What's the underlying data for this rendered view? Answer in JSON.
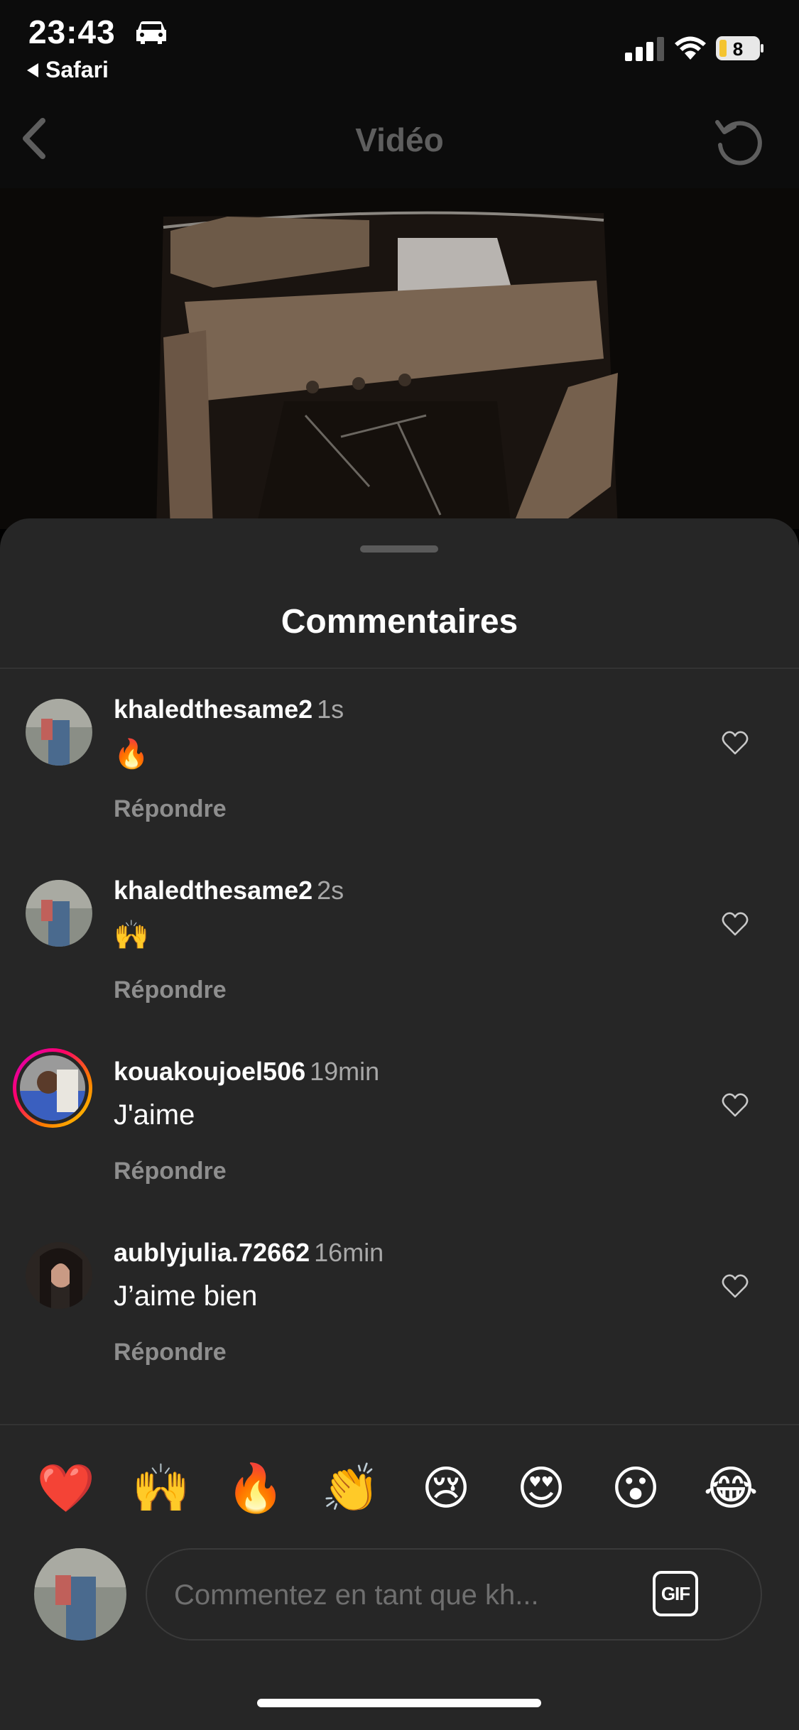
{
  "status_bar": {
    "time": "23:43",
    "back_app": "Safari",
    "battery": "8"
  },
  "nav": {
    "title": "Vidéo"
  },
  "sheet": {
    "title": "Commentaires"
  },
  "comments": [
    {
      "user": "khaledthesame2",
      "time": "1s",
      "text": "🔥",
      "reply": "Répondre"
    },
    {
      "user": "khaledthesame2",
      "time": "2s",
      "text": "🙌",
      "reply": "Répondre"
    },
    {
      "user": "kouakoujoel506",
      "time": "19min",
      "text": "J'aime",
      "reply": "Répondre"
    },
    {
      "user": "aublyjulia.72662",
      "time": "16min",
      "text": "J’aime bien",
      "reply": "Répondre"
    }
  ],
  "quick_reactions": [
    "❤️",
    "🙌",
    "🔥",
    "👏",
    "😢",
    "😍",
    "😮",
    "😂"
  ],
  "composer": {
    "placeholder": "Commentez en tant que kh...",
    "gif_label": "GIF"
  }
}
